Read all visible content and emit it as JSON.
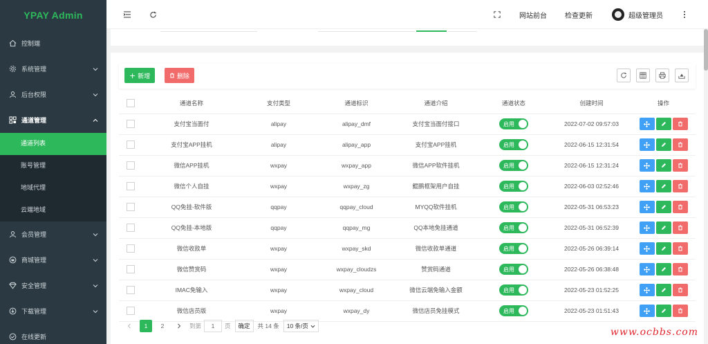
{
  "app": {
    "title": "YPAY Admin"
  },
  "sidebar": {
    "items": [
      {
        "label": "控制端",
        "icon": "home-icon"
      },
      {
        "label": "系统管理",
        "icon": "gear-icon"
      },
      {
        "label": "后台权限",
        "icon": "user-icon"
      },
      {
        "label": "通道管理",
        "icon": "channel-icon"
      },
      {
        "label": "会员管理",
        "icon": "user-icon"
      },
      {
        "label": "商城管理",
        "icon": "shop-icon"
      },
      {
        "label": "安全管理",
        "icon": "diamond-icon"
      },
      {
        "label": "下载管理",
        "icon": "download-icon"
      },
      {
        "label": "在线更新",
        "icon": "check-icon"
      }
    ],
    "subitems": [
      {
        "label": "通道列表"
      },
      {
        "label": "账号管理"
      },
      {
        "label": "地域代理"
      },
      {
        "label": "云端地域"
      }
    ]
  },
  "header": {
    "front_label": "网站前台",
    "update_label": "检查更新",
    "user_label": "超级管理员"
  },
  "toolbar": {
    "add_label": "新增",
    "delete_label": "删除"
  },
  "table": {
    "columns": [
      "通道名称",
      "支付类型",
      "通道标识",
      "通道介绍",
      "通道状态",
      "创建时间",
      "操作"
    ],
    "rows": [
      {
        "name": "支付宝当面付",
        "type": "alipay",
        "code": "alipay_dmf",
        "desc": "支付宝当面付接口",
        "status": "启用",
        "time": "2022-07-02 09:57:03"
      },
      {
        "name": "支付宝APP挂机",
        "type": "alipay",
        "code": "alipay_app",
        "desc": "支付宝APP挂机",
        "status": "启用",
        "time": "2022-06-15 12:31:54"
      },
      {
        "name": "微信APP挂机",
        "type": "wxpay",
        "code": "wxpay_app",
        "desc": "微信APP软件挂机",
        "status": "启用",
        "time": "2022-06-15 12:31:24"
      },
      {
        "name": "微信个人自挂",
        "type": "wxpay",
        "code": "wxpay_zg",
        "desc": "鲲鹏框架用户自挂",
        "status": "启用",
        "time": "2022-06-03 02:52:46"
      },
      {
        "name": "QQ免挂-软件版",
        "type": "qqpay",
        "code": "qqpay_cloud",
        "desc": "MYQQ软件挂机",
        "status": "启用",
        "time": "2022-05-31 06:53:23"
      },
      {
        "name": "QQ免挂-本地版",
        "type": "qqpay",
        "code": "qqpay_mg",
        "desc": "QQ本地免挂通道",
        "status": "启用",
        "time": "2022-05-31 06:52:39"
      },
      {
        "name": "微信收款单",
        "type": "wxpay",
        "code": "wxpay_skd",
        "desc": "微信收款单通道",
        "status": "启用",
        "time": "2022-05-26 06:39:14"
      },
      {
        "name": "微信赞赏码",
        "type": "wxpay",
        "code": "wxpay_cloudzs",
        "desc": "赞赏码通道",
        "status": "启用",
        "time": "2022-05-26 06:38:48"
      },
      {
        "name": "IMAC免输入",
        "type": "wxpay",
        "code": "wxpay_cloud",
        "desc": "微信云端免输入金额",
        "status": "启用",
        "time": "2022-05-23 01:52:25"
      },
      {
        "name": "微信店员版",
        "type": "wxpay",
        "code": "wxpay_dy",
        "desc": "微信店员免挂模式",
        "status": "启用",
        "time": "2022-05-23 01:51:43"
      }
    ]
  },
  "pager": {
    "page1": "1",
    "page2": "2",
    "goto_label": "到第",
    "page_value": "1",
    "page_unit": "页",
    "confirm_label": "确定",
    "total_label": "共 14 条",
    "page_size": "10 条/页"
  },
  "watermark": "www.ocbbs.com",
  "colors": {
    "accent": "#2eb85c",
    "danger": "#f26b6b",
    "info": "#3fa0f5",
    "sidebar": "#2b3a42"
  }
}
